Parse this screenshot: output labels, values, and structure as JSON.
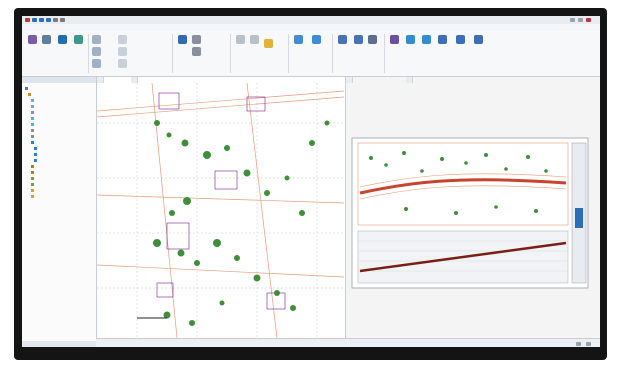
{
  "title_bar": {
    "title": ""
  },
  "ribbon_tabs": [
    "",
    "",
    "",
    "",
    "",
    "",
    "",
    "",
    "",
    "",
    "",
    "",
    "",
    "",
    "",
    "",
    "",
    "",
    ""
  ],
  "toolspace": {
    "header": "",
    "footer_tab": ""
  },
  "tree_items": [
    "",
    "",
    "",
    "",
    "",
    "",
    "",
    "",
    "",
    "",
    "",
    "",
    "",
    "",
    "",
    "",
    "",
    "",
    ""
  ],
  "drawing_tabs": [
    "",
    "",
    ""
  ],
  "layout_tabs": [
    "",
    ""
  ],
  "status": {
    "text": ""
  },
  "colors": {
    "tree_green": "#3f8f3a",
    "road_red": "#c9442e",
    "parcel_purple": "#8e3e9c",
    "grid_orange": "#e79a7a"
  }
}
